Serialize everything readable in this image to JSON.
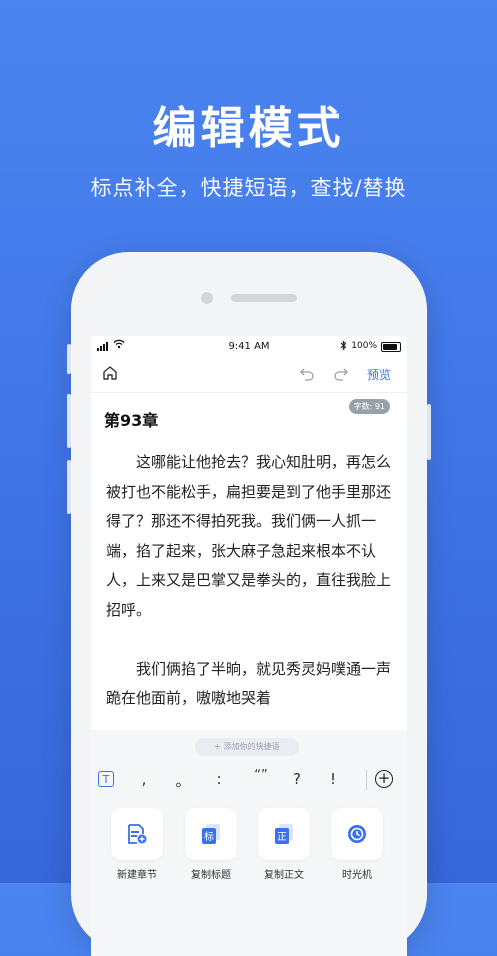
{
  "hero": {
    "title": "编辑模式",
    "subtitle": "标点补全，快捷短语，查找/替换"
  },
  "status": {
    "time": "9:41 AM",
    "battery": "100%"
  },
  "toolbar": {
    "preview_label": "预览"
  },
  "chapter": {
    "title": "第93章",
    "word_count": "字数: 91",
    "paragraphs": [
      "这哪能让他抢去？我心知肚明，再怎么被打也不能松手，扁担要是到了他手里那还得了？那还不得拍死我。我们俩一人抓一端，掐了起来，张大麻子急起来根本不认人，上来又是巴掌又是拳头的，直往我脸上招呼。",
      "我们俩掐了半晌，就见秀灵妈噗通一声跪在他面前，嗷嗷地哭着"
    ]
  },
  "quick_phrase": {
    "label": "+ 添加你的快捷语"
  },
  "punctuation": [
    ",",
    "。",
    ":",
    "“”",
    "?",
    "!"
  ],
  "actions": [
    {
      "label": "新建章节",
      "icon": "new-chapter-icon",
      "glyph": ""
    },
    {
      "label": "复制标题",
      "icon": "copy-title-icon",
      "glyph": "标"
    },
    {
      "label": "复制正文",
      "icon": "copy-body-icon",
      "glyph": "正"
    },
    {
      "label": "时光机",
      "icon": "time-machine-icon",
      "glyph": ""
    }
  ],
  "colors": {
    "accent": "#3a6ff0",
    "background": "#4b85f0"
  }
}
